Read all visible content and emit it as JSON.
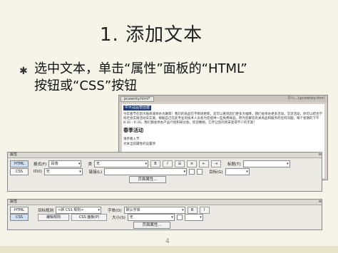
{
  "slide": {
    "title": "1. 添加文本",
    "bullet_line1": "选中文本，单击“属性”面板的“HTML”",
    "bullet_line2": "按钮或“CSS”按钮",
    "page_number": "4"
  },
  "document": {
    "tab_label": "pcawnky.html*",
    "path_text": "D:\\\\...\\\\pcawnky.html",
    "highlight_text": "中大冠品管团建",
    "paragraph": "今年春节在新大陆商城举办大酬宾！我们的商品在不断地更新，您可以看到您们更多大幅降，我们会举办更多活动。交流活动，你可以结合学校社会实践活动去实施，根据自己在此专业的技术人员会为您提供一些免费样品。所为您解答有关商品和服务的任何问题。每个星期的下午8:30 - 6:30。我们都会举办产品介绍和研讨会。欢迎惠顾，它存让您的周末变得不少的丰富！",
    "heading": "春季活动",
    "line1": "请参看入节",
    "line2": "文本当前属性的设置项",
    "note": "*活动所提供的样品是免费的。"
  },
  "html_panel": {
    "header": "属性",
    "html_btn": "HTML",
    "css_btn": "CSS",
    "format_label": "格式(F)",
    "format_value": "段落",
    "class_label": "类",
    "class_value": "无",
    "id_label": "ID(I)",
    "id_value": "无",
    "link_label": "链接(L)",
    "title_label": "标题(T)",
    "target_label": "目标(G)",
    "page_props": "页面属性...",
    "list_btn": "列表项目..."
  },
  "css_panel": {
    "header": "属性",
    "html_btn": "HTML",
    "css_btn": "CSS",
    "target_rule_label": "目标规则",
    "target_rule_value": "<新 CSS 规则>",
    "font_label": "字体(O)",
    "font_value": "默认字体",
    "edit_rule_btn": "编辑规则",
    "css_panel_btn": "CSS 面板(P)",
    "size_label": "大小(S)",
    "size_value": "无",
    "page_props": "页面属性..."
  }
}
